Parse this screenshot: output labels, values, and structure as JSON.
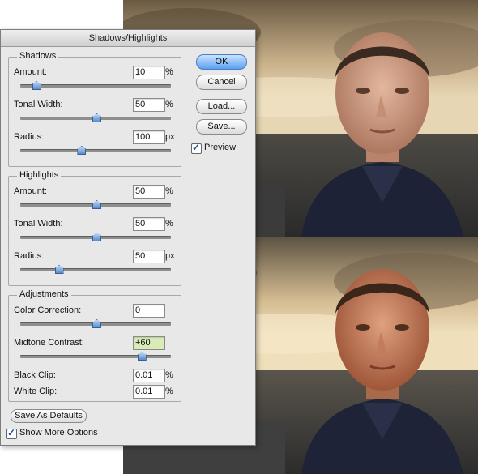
{
  "dialog": {
    "title": "Shadows/Highlights",
    "shadows": {
      "title": "Shadows",
      "amount": {
        "label": "Amount:",
        "value": "10",
        "unit": "%",
        "level": 0.1
      },
      "tonal_width": {
        "label": "Tonal Width:",
        "value": "50",
        "unit": "%",
        "level": 0.5
      },
      "radius": {
        "label": "Radius:",
        "value": "100",
        "unit": "px",
        "level": 0.4
      }
    },
    "highlights": {
      "title": "Highlights",
      "amount": {
        "label": "Amount:",
        "value": "50",
        "unit": "%",
        "level": 0.5
      },
      "tonal_width": {
        "label": "Tonal Width:",
        "value": "50",
        "unit": "%",
        "level": 0.5
      },
      "radius": {
        "label": "Radius:",
        "value": "50",
        "unit": "px",
        "level": 0.25
      }
    },
    "adjustments": {
      "title": "Adjustments",
      "color_correction": {
        "label": "Color Correction:",
        "value": "0",
        "level": 0.5
      },
      "midtone_contrast": {
        "label": "Midtone Contrast:",
        "value": "+60",
        "level": 0.8
      },
      "black_clip": {
        "label": "Black Clip:",
        "value": "0.01",
        "unit": "%"
      },
      "white_clip": {
        "label": "White Clip:",
        "value": "0.01",
        "unit": "%"
      }
    },
    "buttons": {
      "ok": "OK",
      "cancel": "Cancel",
      "load": "Load...",
      "save": "Save...",
      "save_defaults": "Save As Defaults"
    },
    "preview": {
      "label": "Preview",
      "checked": true
    },
    "show_more": {
      "label": "Show More Options",
      "checked": true
    }
  }
}
